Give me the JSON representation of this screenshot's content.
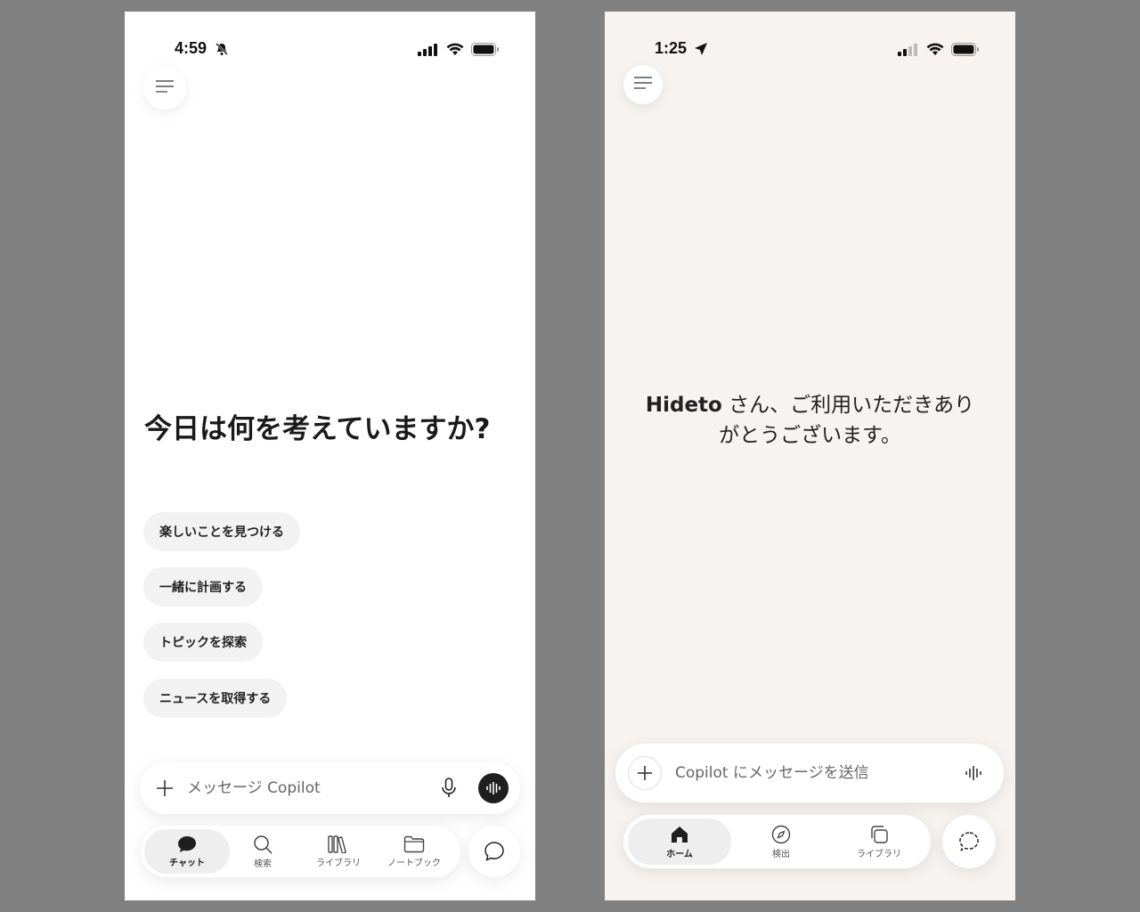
{
  "left": {
    "status": {
      "time": "4:59"
    },
    "greeting": "今日は何を考えていますか?",
    "suggestions": [
      "楽しいことを見つける",
      "一緒に計画する",
      "トピックを探索",
      "ニュースを取得する"
    ],
    "composer": {
      "placeholder": "メッセージ Copilot"
    },
    "nav": [
      "チャット",
      "検索",
      "ライブラリ",
      "ノートブック"
    ]
  },
  "right": {
    "status": {
      "time": "1:25"
    },
    "welcome": {
      "name": "Hideto",
      "line1": " さん、ご利用いただきあり",
      "line2": "がとうございます。"
    },
    "composer": {
      "placeholder": "Copilot にメッセージを送信"
    },
    "nav": [
      "ホーム",
      "検出",
      "ライブラリ"
    ]
  },
  "colors": {
    "left_bg": "#ffffff",
    "right_bg": "#f6f3f0",
    "backdrop": "#808080"
  }
}
